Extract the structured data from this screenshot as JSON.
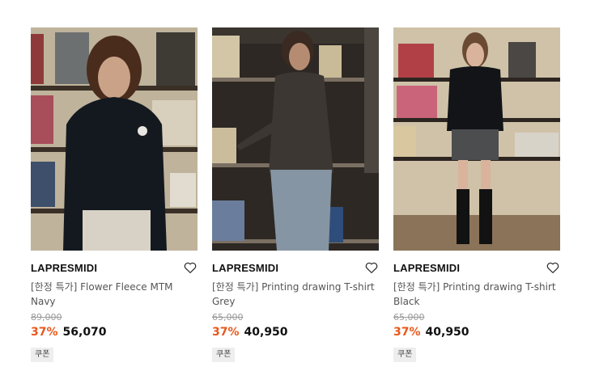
{
  "products": [
    {
      "brand": "LAPRESMIDI",
      "title": "[한정 특가] Flower Fleece MTM Navy",
      "original_price": "89,000",
      "discount": "37%",
      "price": "56,070",
      "coupon": "쿠폰",
      "heart_icon": "heart-outline-icon"
    },
    {
      "brand": "LAPRESMIDI",
      "title": "[한정 특가] Printing drawing T-shirt Grey",
      "original_price": "65,000",
      "discount": "37%",
      "price": "40,950",
      "coupon": "쿠폰",
      "heart_icon": "heart-outline-icon"
    },
    {
      "brand": "LAPRESMIDI",
      "title": "[한정 특가] Printing drawing T-shirt Black",
      "original_price": "65,000",
      "discount": "37%",
      "price": "40,950",
      "coupon": "쿠폰",
      "heart_icon": "heart-outline-icon"
    }
  ],
  "colors": {
    "discount": "#e8581b",
    "coupon_bg": "#eeeeee"
  }
}
